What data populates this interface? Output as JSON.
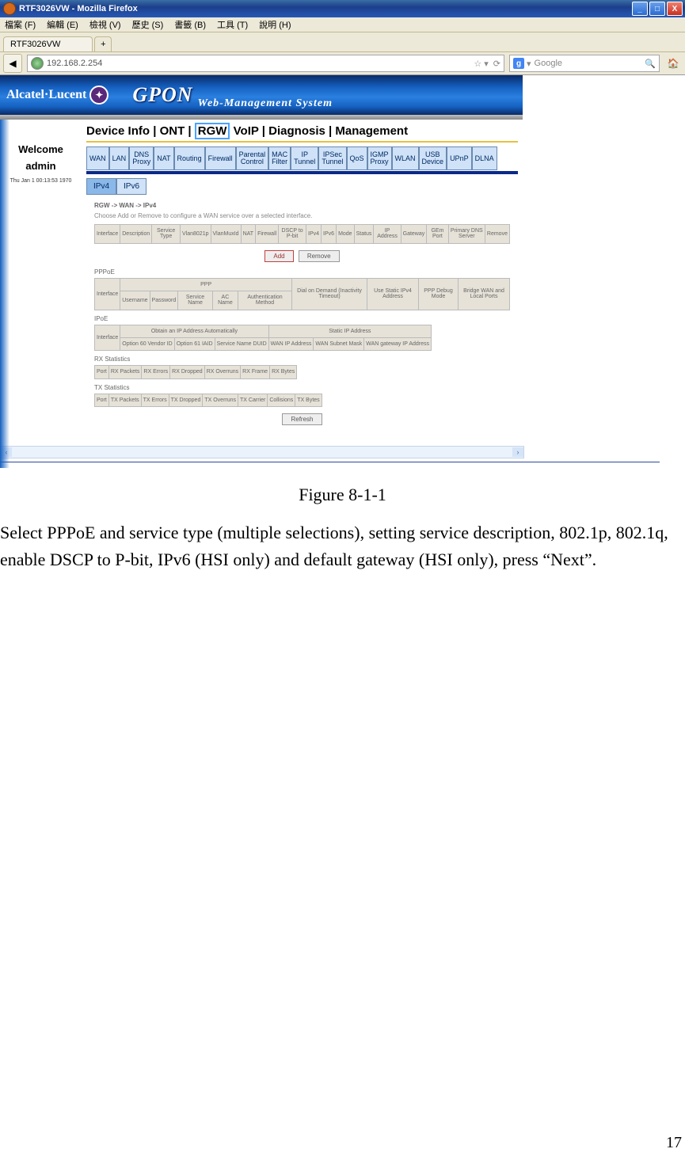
{
  "window": {
    "title": "RTF3026VW - Mozilla Firefox"
  },
  "ff_menu": [
    "檔案 (F)",
    "編輯 (E)",
    "檢視 (V)",
    "歷史 (S)",
    "書籤 (B)",
    "工具 (T)",
    "說明 (H)"
  ],
  "tab_title": "RTF3026VW",
  "url": "192.168.2.254",
  "reload": "⟳",
  "search_placeholder": "Google",
  "brand": "Alcatel·Lucent",
  "gpon": "GPON",
  "wms": "Web-Management System",
  "sidebar": {
    "welcome": "Welcome",
    "user": "admin",
    "ts": "Thu Jan 1 00:13:53 1970"
  },
  "topnav": {
    "a": "Device Info",
    "b": "ONT",
    "c": "RGW",
    "d": "VoIP",
    "e": "Diagnosis",
    "f": "Management"
  },
  "rgw_tabs": [
    "WAN",
    "LAN",
    "DNS Proxy",
    "NAT",
    "Routing",
    "Firewall",
    "Parental Control",
    "MAC Filter",
    "IP Tunnel",
    "IPSec Tunnel",
    "QoS",
    "IGMP Proxy",
    "WLAN",
    "USB Device",
    "UPnP",
    "DLNA"
  ],
  "wan_sub": [
    "IPv4",
    "IPv6"
  ],
  "breadcrumb": "RGW -> WAN -> IPv4",
  "hint": "Choose Add or Remove to configure a WAN service over a selected interface.",
  "tbl_main": [
    "Interface",
    "Description",
    "Service Type",
    "Vlan8021p",
    "VlanMuxId",
    "NAT",
    "Firewall",
    "DSCP to P-bit",
    "IPv4",
    "IPv6",
    "Mode",
    "Status",
    "IP Address",
    "Gateway",
    "GEm Port",
    "Primary DNS Server",
    "Remove"
  ],
  "btn_add": "Add",
  "btn_remove": "Remove",
  "sec_pppoe": "PPPoE",
  "tbl_ppp": {
    "r1c1": "Interface",
    "r1c2": "PPP",
    "r1c3": "Dial on Demand (Inactivity Timeout)",
    "r1c4": "Use Static IPv4 Address",
    "r1c5": "PPP Debug Mode",
    "r1c6": "Bridge WAN and Local Ports",
    "r2": [
      "Username",
      "Password",
      "Service Name",
      "AC Name",
      "Authentication Method"
    ]
  },
  "sec_ipoe": "IPoE",
  "tbl_ipoe": {
    "r1c1": "Interface",
    "r1c2": "Obtain an IP Address Automatically",
    "r1c3": "Static IP Address",
    "r2": [
      "Option 60 Vendor ID",
      "Option 61 IAID",
      "Service Name DUID",
      "WAN IP Address",
      "WAN Subnet Mask",
      "WAN gateway IP Address"
    ]
  },
  "sec_rx": "RX Statistics",
  "tbl_rx": [
    "Port",
    "RX Packets",
    "RX Errors",
    "RX Dropped",
    "RX Overruns",
    "RX Frame",
    "RX Bytes"
  ],
  "sec_tx": "TX Statistics",
  "tbl_tx": [
    "Port",
    "TX Packets",
    "TX Errors",
    "TX Dropped",
    "TX Overruns",
    "TX Carrier",
    "Collisions",
    "TX Bytes"
  ],
  "btn_refresh": "Refresh",
  "figure": "Figure 8-1-1",
  "para": "Select PPPoE and service type (multiple selections), setting service description, 802.1p, 802.1q, enable DSCP to P-bit, IPv6 (HSI only) and default gateway (HSI only), press “Next”.",
  "page_number": "17"
}
